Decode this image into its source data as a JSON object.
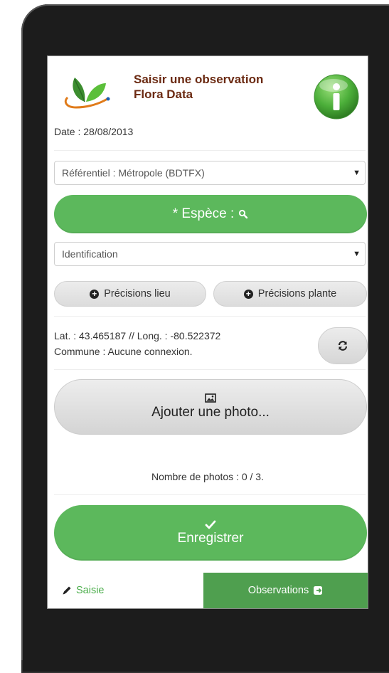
{
  "header": {
    "title_line1": "Saisir une observation",
    "title_line2": "Flora Data",
    "logo": "flora-data-leaf-logo",
    "info_icon": "info-icon"
  },
  "form": {
    "date": "Date : 28/08/2013",
    "referentiel": "Référentiel : Métropole (BDTFX)",
    "espece_label": "* Espèce :",
    "identification": "Identification",
    "precisions_lieu": "Précisions lieu",
    "precisions_plante": "Précisions plante",
    "geo_line1": "Lat. : 43.465187 // Long. : -80.522372",
    "geo_line2": "Commune : Aucune connexion.",
    "photo_button": "Ajouter une photo...",
    "photo_count": "Nombre de photos : 0 / 3.",
    "save_button": "Enregistrer"
  },
  "tabs": {
    "saisie": "Saisie",
    "observations": "Observations"
  },
  "colors": {
    "accent_green": "#5cb85c",
    "tab_green": "#4f9f4f",
    "title_brown": "#6b2a12"
  }
}
